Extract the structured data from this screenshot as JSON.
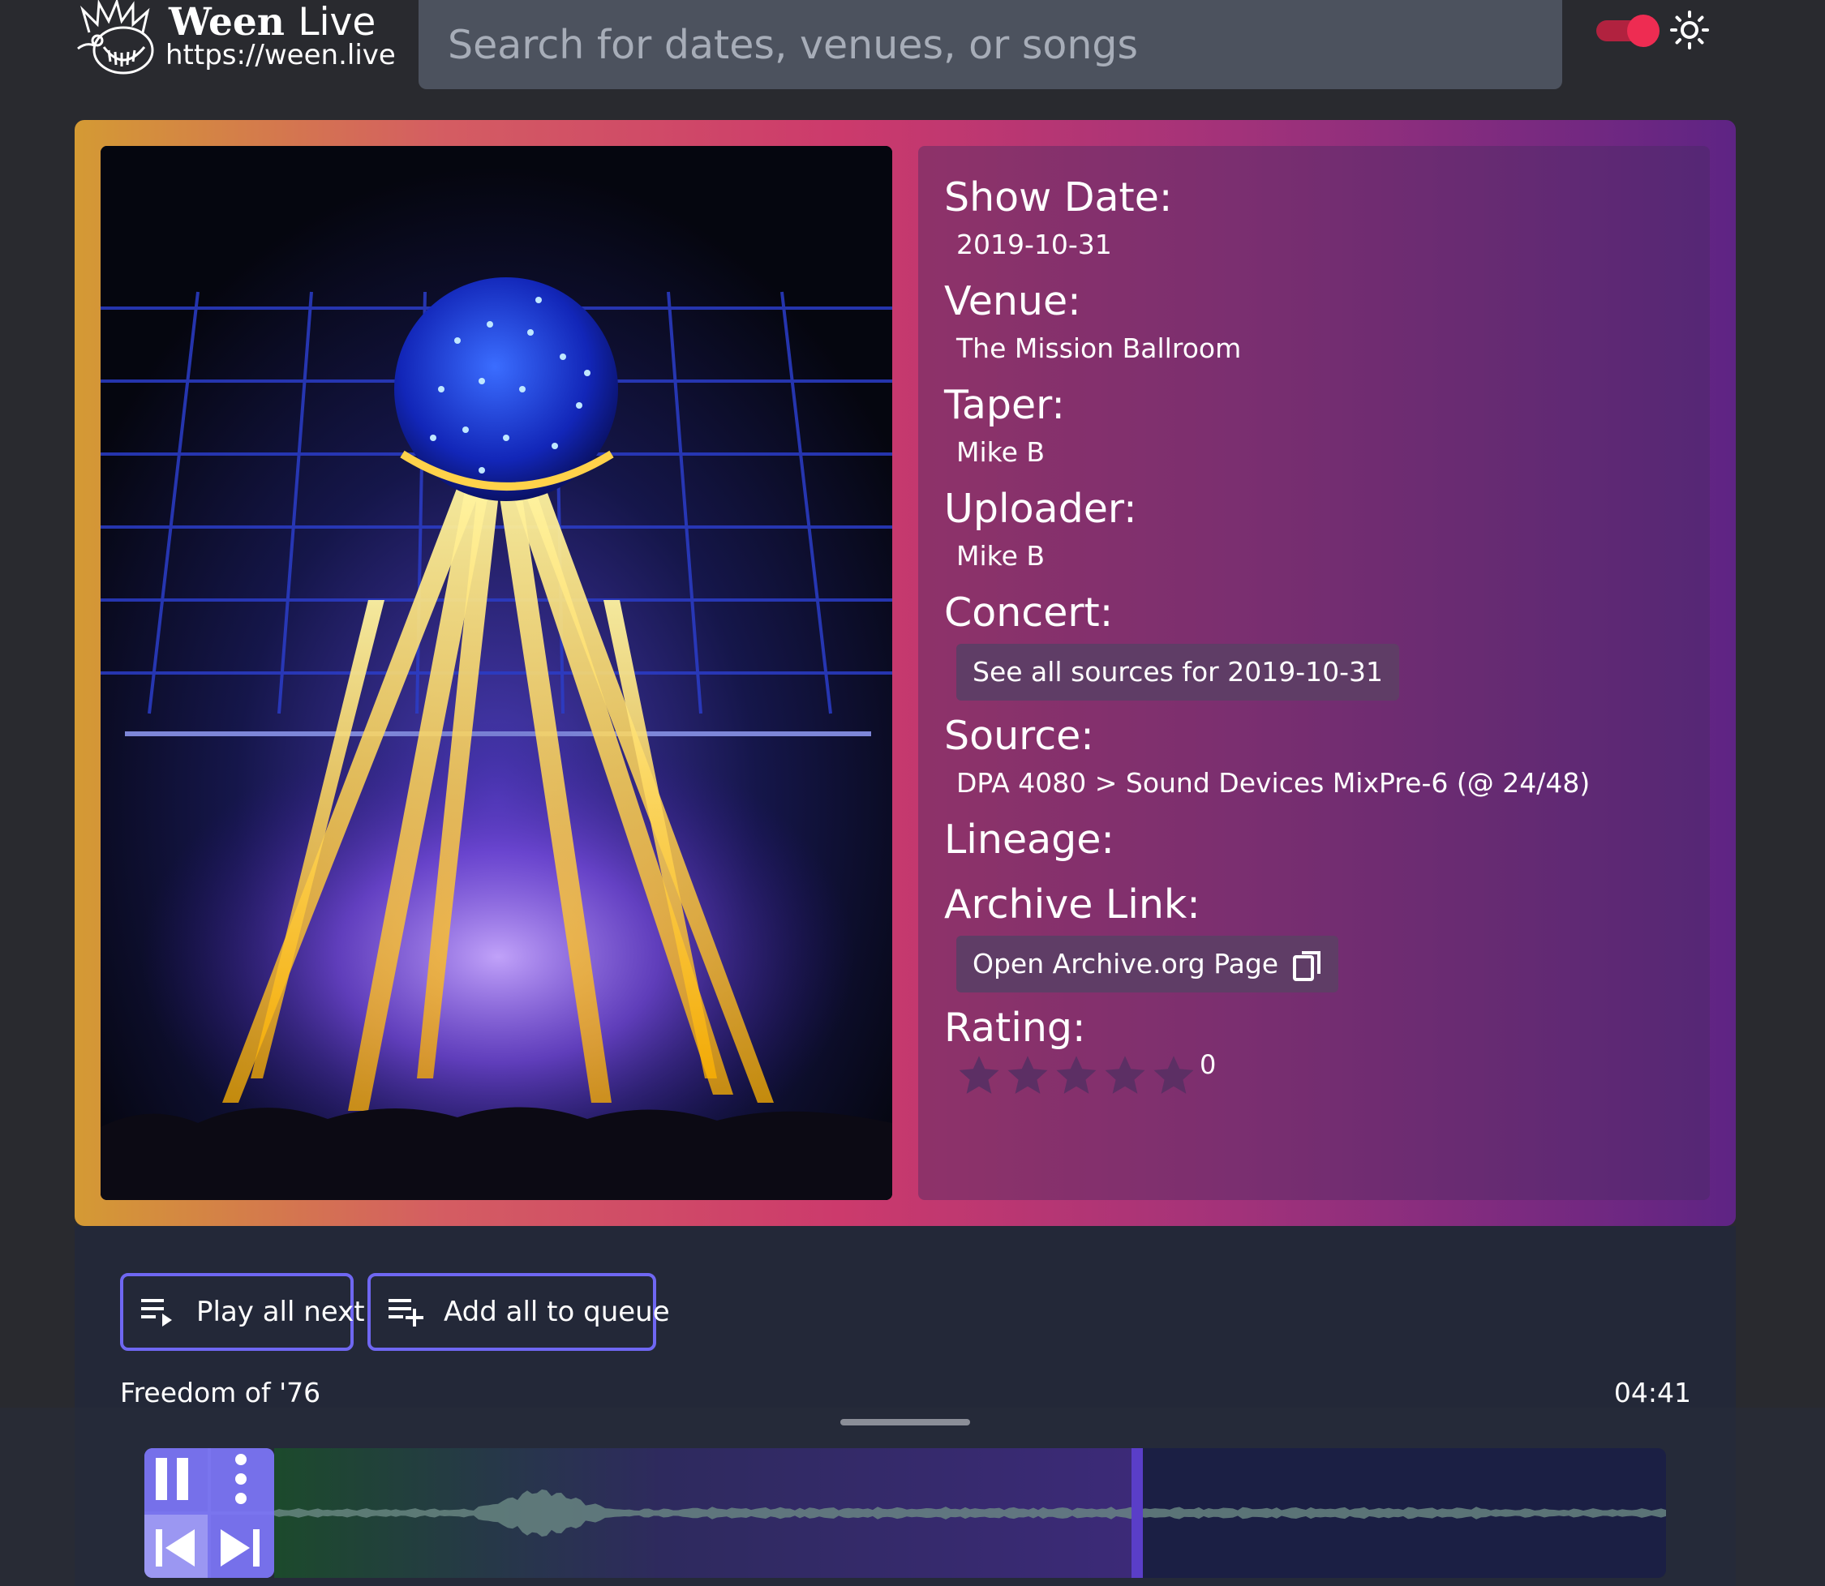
{
  "header": {
    "logo": {
      "word": "Ween",
      "live": "Live",
      "url": "https://ween.live"
    },
    "search_placeholder": "Search for dates, venues, or songs",
    "theme_toggle_on": true
  },
  "show": {
    "fields": [
      {
        "label": "Show Date:",
        "value": "2019-10-31"
      },
      {
        "label": "Venue:",
        "value": "The Mission Ballroom"
      },
      {
        "label": "Taper:",
        "value": "Mike B"
      },
      {
        "label": "Uploader:",
        "value": "Mike B"
      }
    ],
    "concert": {
      "label": "Concert:",
      "button": "See all sources for 2019-10-31"
    },
    "source": {
      "label": "Source:",
      "value": "DPA 4080 > Sound Devices MixPre-6 (@ 24/48)"
    },
    "lineage": {
      "label": "Lineage:"
    },
    "archive": {
      "label": "Archive Link:",
      "button": "Open Archive.org Page"
    },
    "rating": {
      "label": "Rating:",
      "stars": 5,
      "count": "0"
    }
  },
  "tracks": {
    "play_all_next": "Play all next",
    "add_all_to_queue": "Add all to queue",
    "current_title": "Freedom of '76",
    "current_duration": "04:41"
  },
  "player": {
    "progress": 0.62,
    "colors": {
      "accent": "#6f67f2",
      "played": "#3a2a72",
      "unplayed": "#1b1f44"
    }
  }
}
